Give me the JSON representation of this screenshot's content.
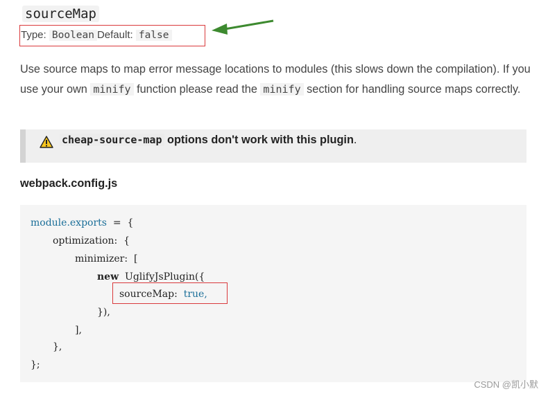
{
  "option": {
    "name": "sourceMap",
    "type_label": "Type:",
    "type_value": "Boolean",
    "default_label": "Default:",
    "default_value": "false"
  },
  "description": {
    "p1": "Use source maps to map error message locations to modules (this slows down the compilation). If you use your own",
    "code1": "minify",
    "p2": "function please read the",
    "code2": "minify",
    "p3": "section for handling source maps correctly."
  },
  "warning": {
    "icon": "warning-triangle-icon",
    "code": "cheap-source-map",
    "text": "options don't work with this plugin",
    "period": "."
  },
  "config": {
    "filename": "webpack.config.js",
    "lines": [
      {
        "a": "module.exports",
        "b": "  =  {"
      },
      {
        "a": "optimization:",
        "b": "  {"
      },
      {
        "a": "minimizer:",
        "b": "  ["
      },
      {
        "a": "new",
        "b": "  UglifyJsPlugin({"
      },
      {
        "a": "sourceMap:",
        "b": "  true,"
      },
      {
        "a": "}),",
        "b": ""
      },
      {
        "a": "],",
        "b": ""
      },
      {
        "a": "},",
        "b": ""
      },
      {
        "a": "};",
        "b": ""
      }
    ]
  },
  "watermark": "CSDN @凯小默",
  "colors": {
    "highlight_border": "#d9393b",
    "arrow": "#3d8a2f",
    "keyword": "#1b6f99"
  }
}
